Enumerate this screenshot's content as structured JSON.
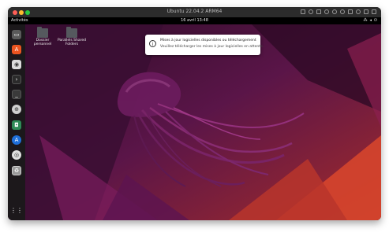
{
  "window": {
    "title": "Ubuntu 22.04.2 ARM64"
  },
  "topbar": {
    "activities": "Activités",
    "clock": "16 avril 13:48"
  },
  "dock": {
    "apps": [
      {
        "name": "Fichiers",
        "icon": "files-icon"
      },
      {
        "name": "Ubuntu Software",
        "icon": "software-icon"
      },
      {
        "name": "Utilitaire",
        "icon": "disk-icon"
      },
      {
        "name": "Terminal",
        "icon": "terminal-icon"
      },
      {
        "name": "Terminal 2",
        "icon": "terminal-icon"
      },
      {
        "name": "Aide",
        "icon": "help-icon"
      },
      {
        "name": "Capture",
        "icon": "camera-icon"
      },
      {
        "name": "App Store",
        "icon": "appstore-icon"
      },
      {
        "name": "Disque",
        "icon": "disc-icon"
      },
      {
        "name": "Corbeille",
        "icon": "trash-icon"
      }
    ],
    "show_apps_icon": "grid-icon"
  },
  "desktop": {
    "icons": [
      {
        "label": "Dossier personnel"
      },
      {
        "label": "Parallels Shared Folders"
      }
    ]
  },
  "notification": {
    "title": "Mises à jour logicielles disponibles ou téléchargement",
    "body": "Veuillez télécharger les mises à jour logicielles en attente."
  },
  "colors": {
    "accent": "#e95420",
    "wallpaper_dark": "#3b0f2e",
    "wallpaper_purple": "#6f1a5a",
    "wallpaper_orange": "#e0512a"
  }
}
